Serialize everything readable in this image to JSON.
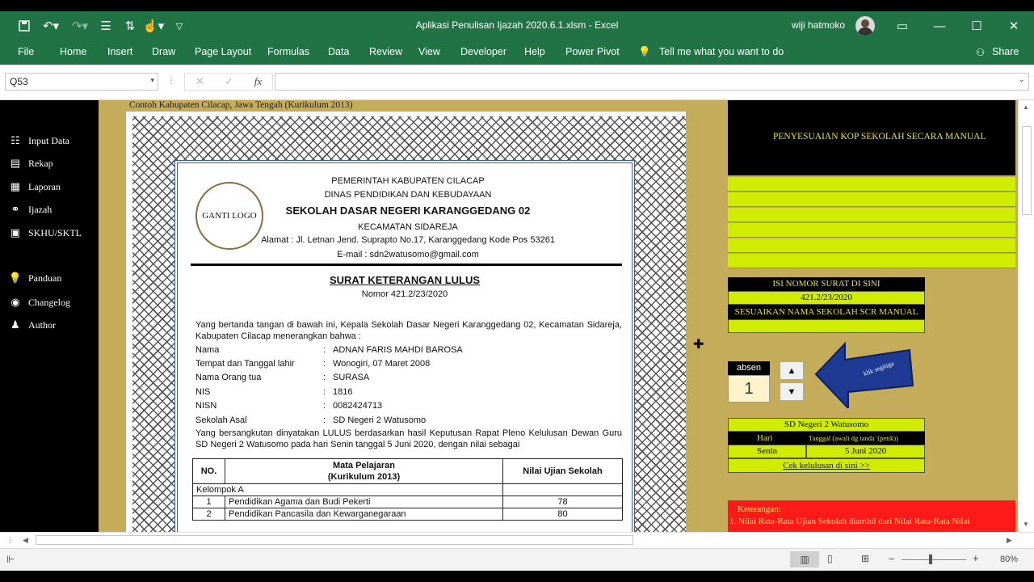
{
  "titlebar": {
    "file_title": "Aplikasi Penulisan Ijazah 2020.6.1.xlsm - Excel",
    "user": "wiji hatmoko"
  },
  "ribbon": {
    "tabs": [
      "File",
      "Home",
      "Insert",
      "Draw",
      "Page Layout",
      "Formulas",
      "Data",
      "Review",
      "View",
      "Developer",
      "Help",
      "Power Pivot"
    ],
    "tell_me": "Tell me what you want to do",
    "share": "Share"
  },
  "formula_bar": {
    "name_box": "Q53",
    "fx": "fx",
    "formula": ""
  },
  "sidebar": {
    "items": [
      "Input Data",
      "Rekap",
      "Laporan",
      "Ijazah",
      "SKHU/SKTL"
    ],
    "items2": [
      "Panduan",
      "Changelog",
      "Author"
    ]
  },
  "sheet": {
    "caption": "Contoh Kabupaten Cilacap, Jawa Tengah (Kurikulum 2013)"
  },
  "certificate": {
    "logo": "GANTI LOGO",
    "kop1": "PEMERINTAH KABUPATEN CILACAP",
    "kop2": "DINAS PENDIDIKAN DAN KEBUDAYAAN",
    "school": "SEKOLAH DASAR NEGERI KARANGGEDANG 02",
    "district": "KECAMATAN SIDAREJA",
    "address": "Alamat : Jl. Letnan Jend. Suprapto No.17, Karanggedang Kode Pos 53261",
    "email": "E-mail : sdn2watusomo@gmail.com",
    "doc_title": "SURAT KETERANGAN LULUS",
    "doc_number": "Nomor 421.2/23/2020",
    "intro": "Yang bertanda tangan di bawah ini, Kepala Sekolah Dasar Negeri Karanggedang 02, Kecamatan Sidareja, Kabupaten Cilacap menerangkan bahwa :",
    "fields": [
      {
        "label": "Nama",
        "value": "ADNAN FARIS MAHDI BAROSA"
      },
      {
        "label": "Tempat dan Tanggal lahir",
        "value": "Wonogiri, 07 Maret 2008"
      },
      {
        "label": "Nama Orang tua",
        "value": "SURASA"
      },
      {
        "label": "NIS",
        "value": "1816"
      },
      {
        "label": "NISN",
        "value": "0082424713"
      },
      {
        "label": "Sekolah Asal",
        "value": "SD Negeri 2 Watusomo"
      }
    ],
    "statement": "Yang bersangkutan dinyatakan LULUS berdasarkan hasil Keputusan Rapat Pleno Kelulusan Dewan Guru SD Negeri 2 Watusomo pada hari Senin tanggal 5 Juni 2020, dengan nilai sebagai",
    "table": {
      "h_no": "NO.",
      "h_mapel": "Mata Pelajaran",
      "h_kur": "(Kurikulum 2013)",
      "h_nilai": "Nilai Ujian Sekolah",
      "group": "Kelompok A",
      "rows": [
        {
          "no": "1",
          "subject": "Pendidikan Agama dan Budi Pekerti",
          "score": "78"
        },
        {
          "no": "2",
          "subject": "Pendidikan Pancasila dan Kewarganegaraan",
          "score": "80"
        }
      ]
    }
  },
  "right_panel": {
    "kop_title": "PENYESUAIAN KOP SEKOLAH SECARA MANUAL",
    "surat_label": "ISI NOMOR SURAT DI SINI",
    "surat_value": "421.2/23/2020",
    "sesuaikan": "SESUAIKAN NAMA SEKOLAH SCR MANUAL",
    "absen_label": "absen",
    "absen_value": "1",
    "arrow_text": "klik segitiga",
    "school_name": "SD Negeri 2 Watusomo",
    "hari_label": "Hari",
    "tanggal_label": "Tanggal (awali dg tanda '(petik))",
    "hari_value": "Senin",
    "tanggal_value": "5 Juni 2020",
    "cek_link": "Cek kelulusan di sini >>",
    "keterangan_title": "Keterangan:",
    "keterangan_1": "1. Nilai Rata-Rata Ujian Sekolah diambil dari Nilai Rata-Rata Nilai"
  },
  "status": {
    "zoom": "80%"
  },
  "colors": {
    "excel_green": "#217346",
    "sheet_bg": "#c4ac5a",
    "lime": "#d0ec00",
    "alert_red": "#ff1a1a",
    "arrow_blue": "#1f3a93"
  }
}
